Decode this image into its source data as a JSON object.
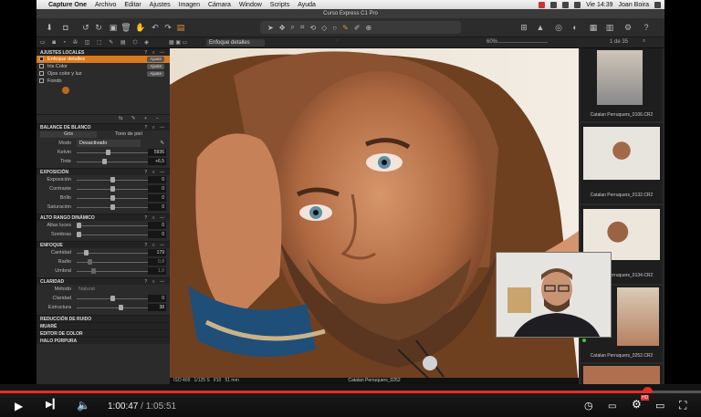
{
  "menubar": {
    "app": "Capture One",
    "items": [
      "Archivo",
      "Editar",
      "Ajustes",
      "Imagen",
      "Cámara",
      "Window",
      "Scripts",
      "Ayuda"
    ],
    "clock": "Vie 14:39",
    "user": "Joan Boira"
  },
  "window_title": "Curso Express C1 Pro",
  "viewer_bar": {
    "tool_label": "Enfoque detalles",
    "zoom": "60%",
    "count": "1 de 35"
  },
  "layers": {
    "title": "AJUSTES LOCALES",
    "items": [
      {
        "label": "Enfoque detalles",
        "tag": "Ajuste"
      },
      {
        "label": "Iris Color",
        "tag": "Ajuste"
      },
      {
        "label": "Ojos color y luz",
        "tag": "Ajuste"
      },
      {
        "label": "Fondo",
        "tag": ""
      }
    ]
  },
  "white_balance": {
    "title": "BALANCE DE BLANCO",
    "tab_active": "Gris",
    "tab_other": "Tono de piel",
    "mode_label": "Modo",
    "mode_value": "Desactivado",
    "rows": [
      {
        "label": "Kelvin",
        "value": "5936"
      },
      {
        "label": "Tinte",
        "value": "+6,5"
      }
    ]
  },
  "exposure": {
    "title": "EXPOSICIÓN",
    "rows": [
      {
        "label": "Exposición",
        "value": "0"
      },
      {
        "label": "Contraste",
        "value": "0"
      },
      {
        "label": "Brillo",
        "value": "0"
      },
      {
        "label": "Saturación",
        "value": "0"
      }
    ]
  },
  "hdr": {
    "title": "ALTO RANGO DINÁMICO",
    "rows": [
      {
        "label": "Altas luces",
        "value": "0"
      },
      {
        "label": "Sombras",
        "value": "0"
      }
    ]
  },
  "sharpening": {
    "title": "ENFOQUE",
    "rows": [
      {
        "label": "Cantidad",
        "value": "179"
      },
      {
        "label": "Radio",
        "value": "0,8"
      },
      {
        "label": "Umbral",
        "value": "1,0"
      }
    ]
  },
  "clarity": {
    "title": "CLARIDAD",
    "method_label": "Método",
    "method_value": "Natural",
    "rows": [
      {
        "label": "Claridad",
        "value": "0"
      },
      {
        "label": "Estructura",
        "value": "38"
      }
    ]
  },
  "collapsed_sections": [
    "REDUCCIÓN DE RUIDO",
    "MUARÉ",
    "EDITOR DE COLOR",
    "HALO PÚRPURA"
  ],
  "filmstrip": [
    {
      "name": "Catalan Perruquers_0106.CR2"
    },
    {
      "name": "Catalan Perruquers_0132.CR2"
    },
    {
      "name": "Catalan Perruquers_0134.CR2"
    },
    {
      "name": "Catalan Perruquers_0252.CR2"
    }
  ],
  "viewer_caption": "Catalan Perruquers_0252",
  "exif": {
    "iso": "ISO 400",
    "shutter": "1/125 S",
    "aperture": "f/10",
    "focal": "51 mm"
  },
  "player": {
    "current_time": "1:00:47",
    "separator": "/",
    "duration": "1:05:51",
    "progress": 0.923,
    "hd_badge": "HD"
  },
  "colors": {
    "accent": "#d87a1e",
    "progress": "#e52d27"
  }
}
